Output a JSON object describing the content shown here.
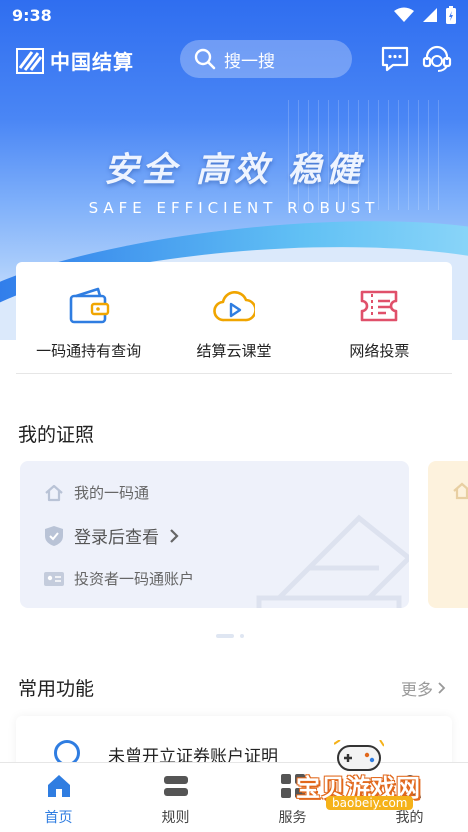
{
  "status": {
    "time": "9:38"
  },
  "header": {
    "logo_text": "中国结算",
    "search_placeholder": "搜一搜"
  },
  "banner": {
    "slogan_cn": "安全 高效 稳健",
    "slogan_en": "SAFE EFFICIENT ROBUST"
  },
  "quick_actions": [
    {
      "label": "一码通持有查询",
      "icon": "wallet-icon"
    },
    {
      "label": "结算云课堂",
      "icon": "cloud-play-icon"
    },
    {
      "label": "网络投票",
      "icon": "ticket-icon"
    }
  ],
  "certificates": {
    "title": "我的证照",
    "card": {
      "name": "我的一码通",
      "action": "登录后查看",
      "account": "投资者一码通账户"
    }
  },
  "functions": {
    "title": "常用功能",
    "more": "更多",
    "items": [
      {
        "label": "未曾开立证券账户证明"
      }
    ]
  },
  "tabs": [
    {
      "label": "首页",
      "active": true
    },
    {
      "label": "规则",
      "active": false
    },
    {
      "label": "服务",
      "active": false
    },
    {
      "label": "我的",
      "active": false
    }
  ],
  "watermark": {
    "text": "宝贝游戏网",
    "url": "baobeiy.com"
  },
  "colors": {
    "brand": "#2f7de1",
    "hero": "#3b79f2"
  }
}
